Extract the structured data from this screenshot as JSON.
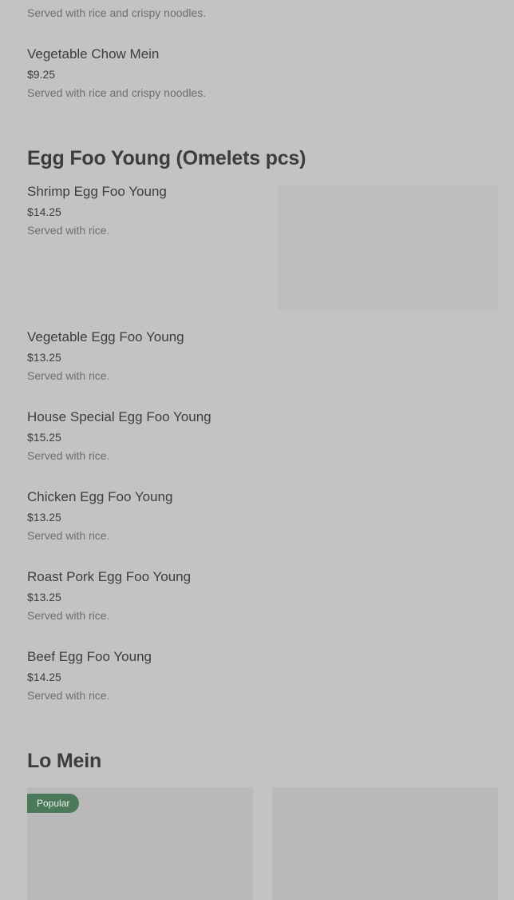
{
  "items": [
    {
      "name": "",
      "price": "",
      "desc": "Served with rice and crispy noodles."
    },
    {
      "name": "Vegetable Chow Mein",
      "price": "$9.25",
      "desc": "Served with rice and crispy noodles."
    }
  ],
  "egg_foo_young": {
    "title": "Egg Foo Young (Omelets pcs)",
    "items": [
      {
        "name": "Shrimp Egg Foo Young",
        "price": "$14.25",
        "desc": "Served with rice."
      },
      {
        "name": "Vegetable Egg Foo Young",
        "price": "$13.25",
        "desc": "Served with rice."
      },
      {
        "name": "House Special Egg Foo Young",
        "price": "$15.25",
        "desc": "Served with rice."
      },
      {
        "name": "Chicken Egg Foo Young",
        "price": "$13.25",
        "desc": "Served with rice."
      },
      {
        "name": "Roast Pork Egg Foo Young",
        "price": "$13.25",
        "desc": "Served with rice."
      },
      {
        "name": "Beef Egg Foo Young",
        "price": "$14.25",
        "desc": "Served with rice."
      }
    ]
  },
  "lo_mein": {
    "title": "Lo Mein",
    "badge": "Popular"
  }
}
